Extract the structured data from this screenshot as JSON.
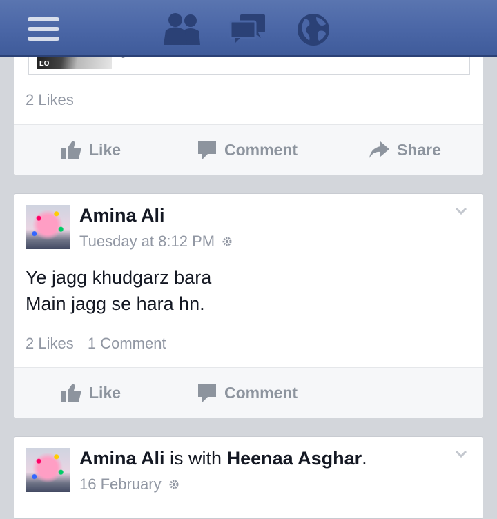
{
  "nav": {
    "menu_icon": "menu-icon",
    "friends_icon": "friend-requests-icon",
    "messages_icon": "messages-icon",
    "globe_icon": "notifications-globe-icon",
    "bar_color": "#4a66a6"
  },
  "post1": {
    "link_domain": "youtube.com",
    "thumb_label": "EO",
    "likes": "2 Likes",
    "actions": {
      "like": "Like",
      "comment": "Comment",
      "share": "Share"
    }
  },
  "post2": {
    "author": "Amina Ali",
    "timestamp": "Tuesday at 8:12 PM",
    "text_line1": "Ye jagg khudgarz bara",
    "text_line2": "Main jagg se hara hn.",
    "likes": "2 Likes",
    "comments": "1 Comment",
    "actions": {
      "like": "Like",
      "comment": "Comment"
    }
  },
  "post3": {
    "author": "Amina Ali",
    "with_text": "is with",
    "tagged": "Heenaa Asghar",
    "period": ".",
    "timestamp": "16 February"
  }
}
